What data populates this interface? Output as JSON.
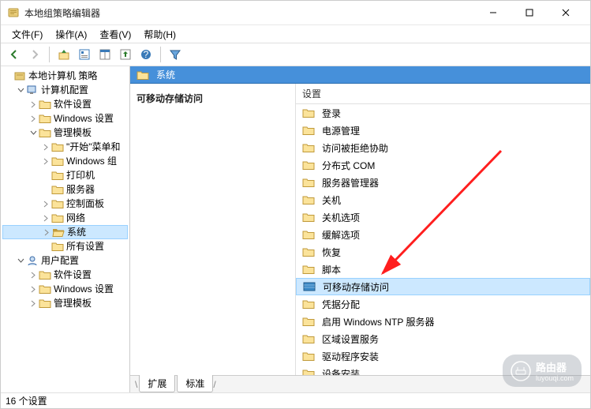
{
  "window": {
    "title": "本地组策略编辑器",
    "wc_min": "—",
    "wc_max": "☐",
    "wc_close": "✕"
  },
  "menubar": [
    {
      "label": "文件(F)"
    },
    {
      "label": "操作(A)"
    },
    {
      "label": "查看(V)"
    },
    {
      "label": "帮助(H)"
    }
  ],
  "toolbar_icons": [
    {
      "name": "back-icon",
      "interact": "true"
    },
    {
      "name": "forward-icon",
      "interact": "true"
    },
    {
      "name": "sep"
    },
    {
      "name": "up-icon",
      "interact": "true"
    },
    {
      "name": "properties-icon",
      "interact": "true"
    },
    {
      "name": "details-icon",
      "interact": "true"
    },
    {
      "name": "export-icon",
      "interact": "true"
    },
    {
      "name": "help-icon",
      "interact": "true"
    },
    {
      "name": "sep"
    },
    {
      "name": "filter-icon",
      "interact": "true"
    }
  ],
  "tree": [
    {
      "depth": 0,
      "tw": "",
      "kind": "root",
      "label": "本地计算机 策略",
      "sel": false
    },
    {
      "depth": 1,
      "tw": "v",
      "kind": "computer",
      "label": "计算机配置",
      "sel": false
    },
    {
      "depth": 2,
      "tw": ">",
      "kind": "folder",
      "label": "软件设置",
      "sel": false
    },
    {
      "depth": 2,
      "tw": ">",
      "kind": "folder",
      "label": "Windows 设置",
      "sel": false
    },
    {
      "depth": 2,
      "tw": "v",
      "kind": "folder",
      "label": "管理模板",
      "sel": false
    },
    {
      "depth": 3,
      "tw": ">",
      "kind": "folder",
      "label": "\"开始\"菜单和",
      "sel": false
    },
    {
      "depth": 3,
      "tw": ">",
      "kind": "folder",
      "label": "Windows 组",
      "sel": false
    },
    {
      "depth": 3,
      "tw": "",
      "kind": "folder",
      "label": "打印机",
      "sel": false
    },
    {
      "depth": 3,
      "tw": "",
      "kind": "folder",
      "label": "服务器",
      "sel": false
    },
    {
      "depth": 3,
      "tw": ">",
      "kind": "folder",
      "label": "控制面板",
      "sel": false
    },
    {
      "depth": 3,
      "tw": ">",
      "kind": "folder",
      "label": "网络",
      "sel": false
    },
    {
      "depth": 3,
      "tw": ">",
      "kind": "folder-open",
      "label": "系统",
      "sel": true
    },
    {
      "depth": 3,
      "tw": "",
      "kind": "folder",
      "label": "所有设置",
      "sel": false
    },
    {
      "depth": 1,
      "tw": "v",
      "kind": "user",
      "label": "用户配置",
      "sel": false
    },
    {
      "depth": 2,
      "tw": ">",
      "kind": "folder",
      "label": "软件设置",
      "sel": false
    },
    {
      "depth": 2,
      "tw": ">",
      "kind": "folder",
      "label": "Windows 设置",
      "sel": false
    },
    {
      "depth": 2,
      "tw": ">",
      "kind": "folder",
      "label": "管理模板",
      "sel": false
    }
  ],
  "content": {
    "header": "系统",
    "left_heading": "可移动存储访问",
    "column": "设置",
    "items": [
      {
        "label": "登录",
        "sel": false,
        "kind": "folder"
      },
      {
        "label": "电源管理",
        "sel": false,
        "kind": "folder"
      },
      {
        "label": "访问被拒绝协助",
        "sel": false,
        "kind": "folder"
      },
      {
        "label": "分布式 COM",
        "sel": false,
        "kind": "folder"
      },
      {
        "label": "服务器管理器",
        "sel": false,
        "kind": "folder"
      },
      {
        "label": "关机",
        "sel": false,
        "kind": "folder"
      },
      {
        "label": "关机选项",
        "sel": false,
        "kind": "folder"
      },
      {
        "label": "缓解选项",
        "sel": false,
        "kind": "folder"
      },
      {
        "label": "恢复",
        "sel": false,
        "kind": "folder"
      },
      {
        "label": "脚本",
        "sel": false,
        "kind": "folder"
      },
      {
        "label": "可移动存储访问",
        "sel": true,
        "kind": "special"
      },
      {
        "label": "凭据分配",
        "sel": false,
        "kind": "folder"
      },
      {
        "label": "启用 Windows NTP 服务器",
        "sel": false,
        "kind": "folder"
      },
      {
        "label": "区域设置服务",
        "sel": false,
        "kind": "folder"
      },
      {
        "label": "驱动程序安装",
        "sel": false,
        "kind": "folder"
      },
      {
        "label": "设备安装",
        "sel": false,
        "kind": "folder"
      }
    ]
  },
  "tabs": [
    {
      "label": "扩展",
      "active": true
    },
    {
      "label": "标准",
      "active": false
    }
  ],
  "status": "16 个设置",
  "watermark": {
    "brand": "路由器",
    "url": "luyouqi.com"
  }
}
